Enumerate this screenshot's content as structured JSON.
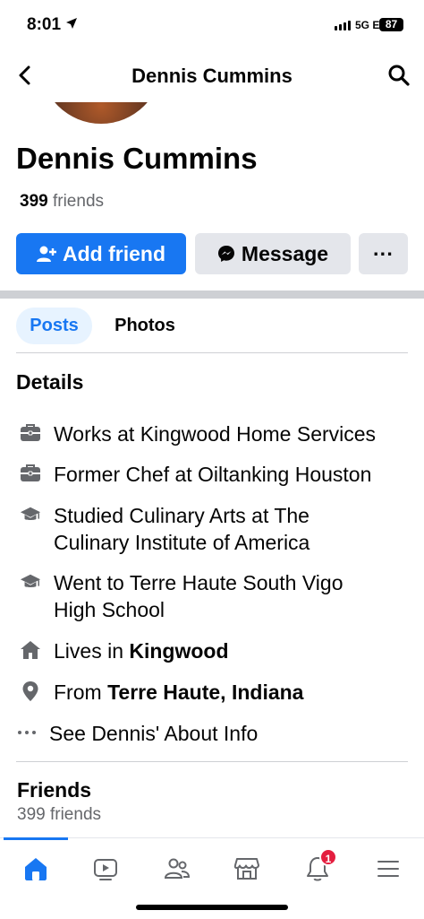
{
  "status_bar": {
    "time": "8:01",
    "network": "5G E",
    "battery": "87"
  },
  "nav": {
    "title": "Dennis Cummins"
  },
  "profile": {
    "name": "Dennis Cummins",
    "friends_number": "399",
    "friends_word": "friends"
  },
  "actions": {
    "add_friend": "Add friend",
    "message": "Message",
    "more": "···"
  },
  "tabs": {
    "posts": "Posts",
    "photos": "Photos"
  },
  "details": {
    "heading": "Details",
    "items": [
      {
        "icon": "briefcase-icon",
        "text": "Works at Kingwood Home Services"
      },
      {
        "icon": "briefcase-icon",
        "text": "Former Chef at Oiltanking Houston"
      },
      {
        "icon": "graduation-cap-icon",
        "line1": "Studied Culinary Arts at The",
        "line2": "Culinary Institute of America"
      },
      {
        "icon": "graduation-cap-icon",
        "line1": "Went to Terre Haute South Vigo",
        "line2": "High School"
      },
      {
        "icon": "house-icon",
        "prefix": "Lives in ",
        "bold": "Kingwood"
      },
      {
        "icon": "location-pin-icon",
        "prefix": "From ",
        "bold": "Terre Haute, Indiana"
      },
      {
        "icon": "more-dots-icon",
        "text": "See Dennis' About Info"
      }
    ]
  },
  "friends_section": {
    "heading": "Friends",
    "subtitle": "399 friends"
  },
  "bottom_nav": {
    "items": [
      "home-icon",
      "video-icon",
      "friends-icon",
      "marketplace-icon",
      "notifications-icon",
      "menu-icon"
    ],
    "notification_badge": "1",
    "accent": "#1877f2"
  },
  "colors": {
    "primary": "#1877f2",
    "badge": "#e41e3f",
    "button_gray": "#e4e6eb",
    "secondary_text": "#65676b"
  }
}
